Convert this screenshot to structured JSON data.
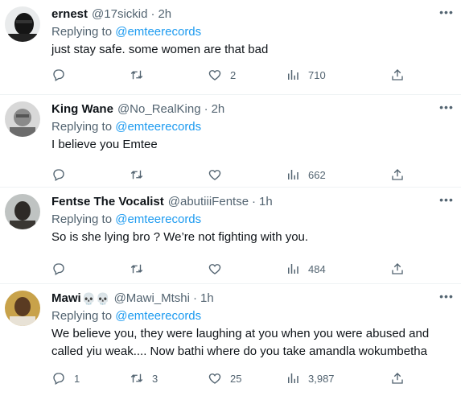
{
  "replying_label": "Replying to",
  "tweets": [
    {
      "name": "ernest",
      "emoji": "",
      "handle": "@17sickid",
      "time": "2h",
      "reply_to": "@emteerecords",
      "text": "just stay safe. some women are that bad",
      "replies": "",
      "retweets": "",
      "likes": "2",
      "views": "710"
    },
    {
      "name": "King Wane",
      "emoji": "",
      "handle": "@No_RealKing",
      "time": "2h",
      "reply_to": "@emteerecords",
      "text": "I believe you Emtee",
      "replies": "",
      "retweets": "",
      "likes": "",
      "views": "662"
    },
    {
      "name": "Fentse The Vocalist",
      "emoji": "",
      "handle": "@abutiiiFentse",
      "time": "1h",
      "reply_to": "@emteerecords",
      "text": "So is she lying bro ? We’re not fighting with you.",
      "replies": "",
      "retweets": "",
      "likes": "",
      "views": "484"
    },
    {
      "name": "Mawi",
      "emoji": "💀💀",
      "handle": "@Mawi_Mtshi",
      "time": "1h",
      "reply_to": "@emteerecords",
      "text": "We believe you, they were laughing at you when you were abused and called yiu weak.... Now bathi where do you take amandla wokumbetha",
      "replies": "1",
      "retweets": "3",
      "likes": "25",
      "views": "3,987"
    }
  ],
  "icons": {
    "more": "more-dots-icon",
    "reply": "reply-bubble-icon",
    "retweet": "retweet-icon",
    "like": "heart-icon",
    "views": "views-bars-icon",
    "share": "share-upload-icon"
  },
  "colors": {
    "link": "#1d9bf0",
    "muted": "#536471",
    "text": "#0f1419"
  }
}
